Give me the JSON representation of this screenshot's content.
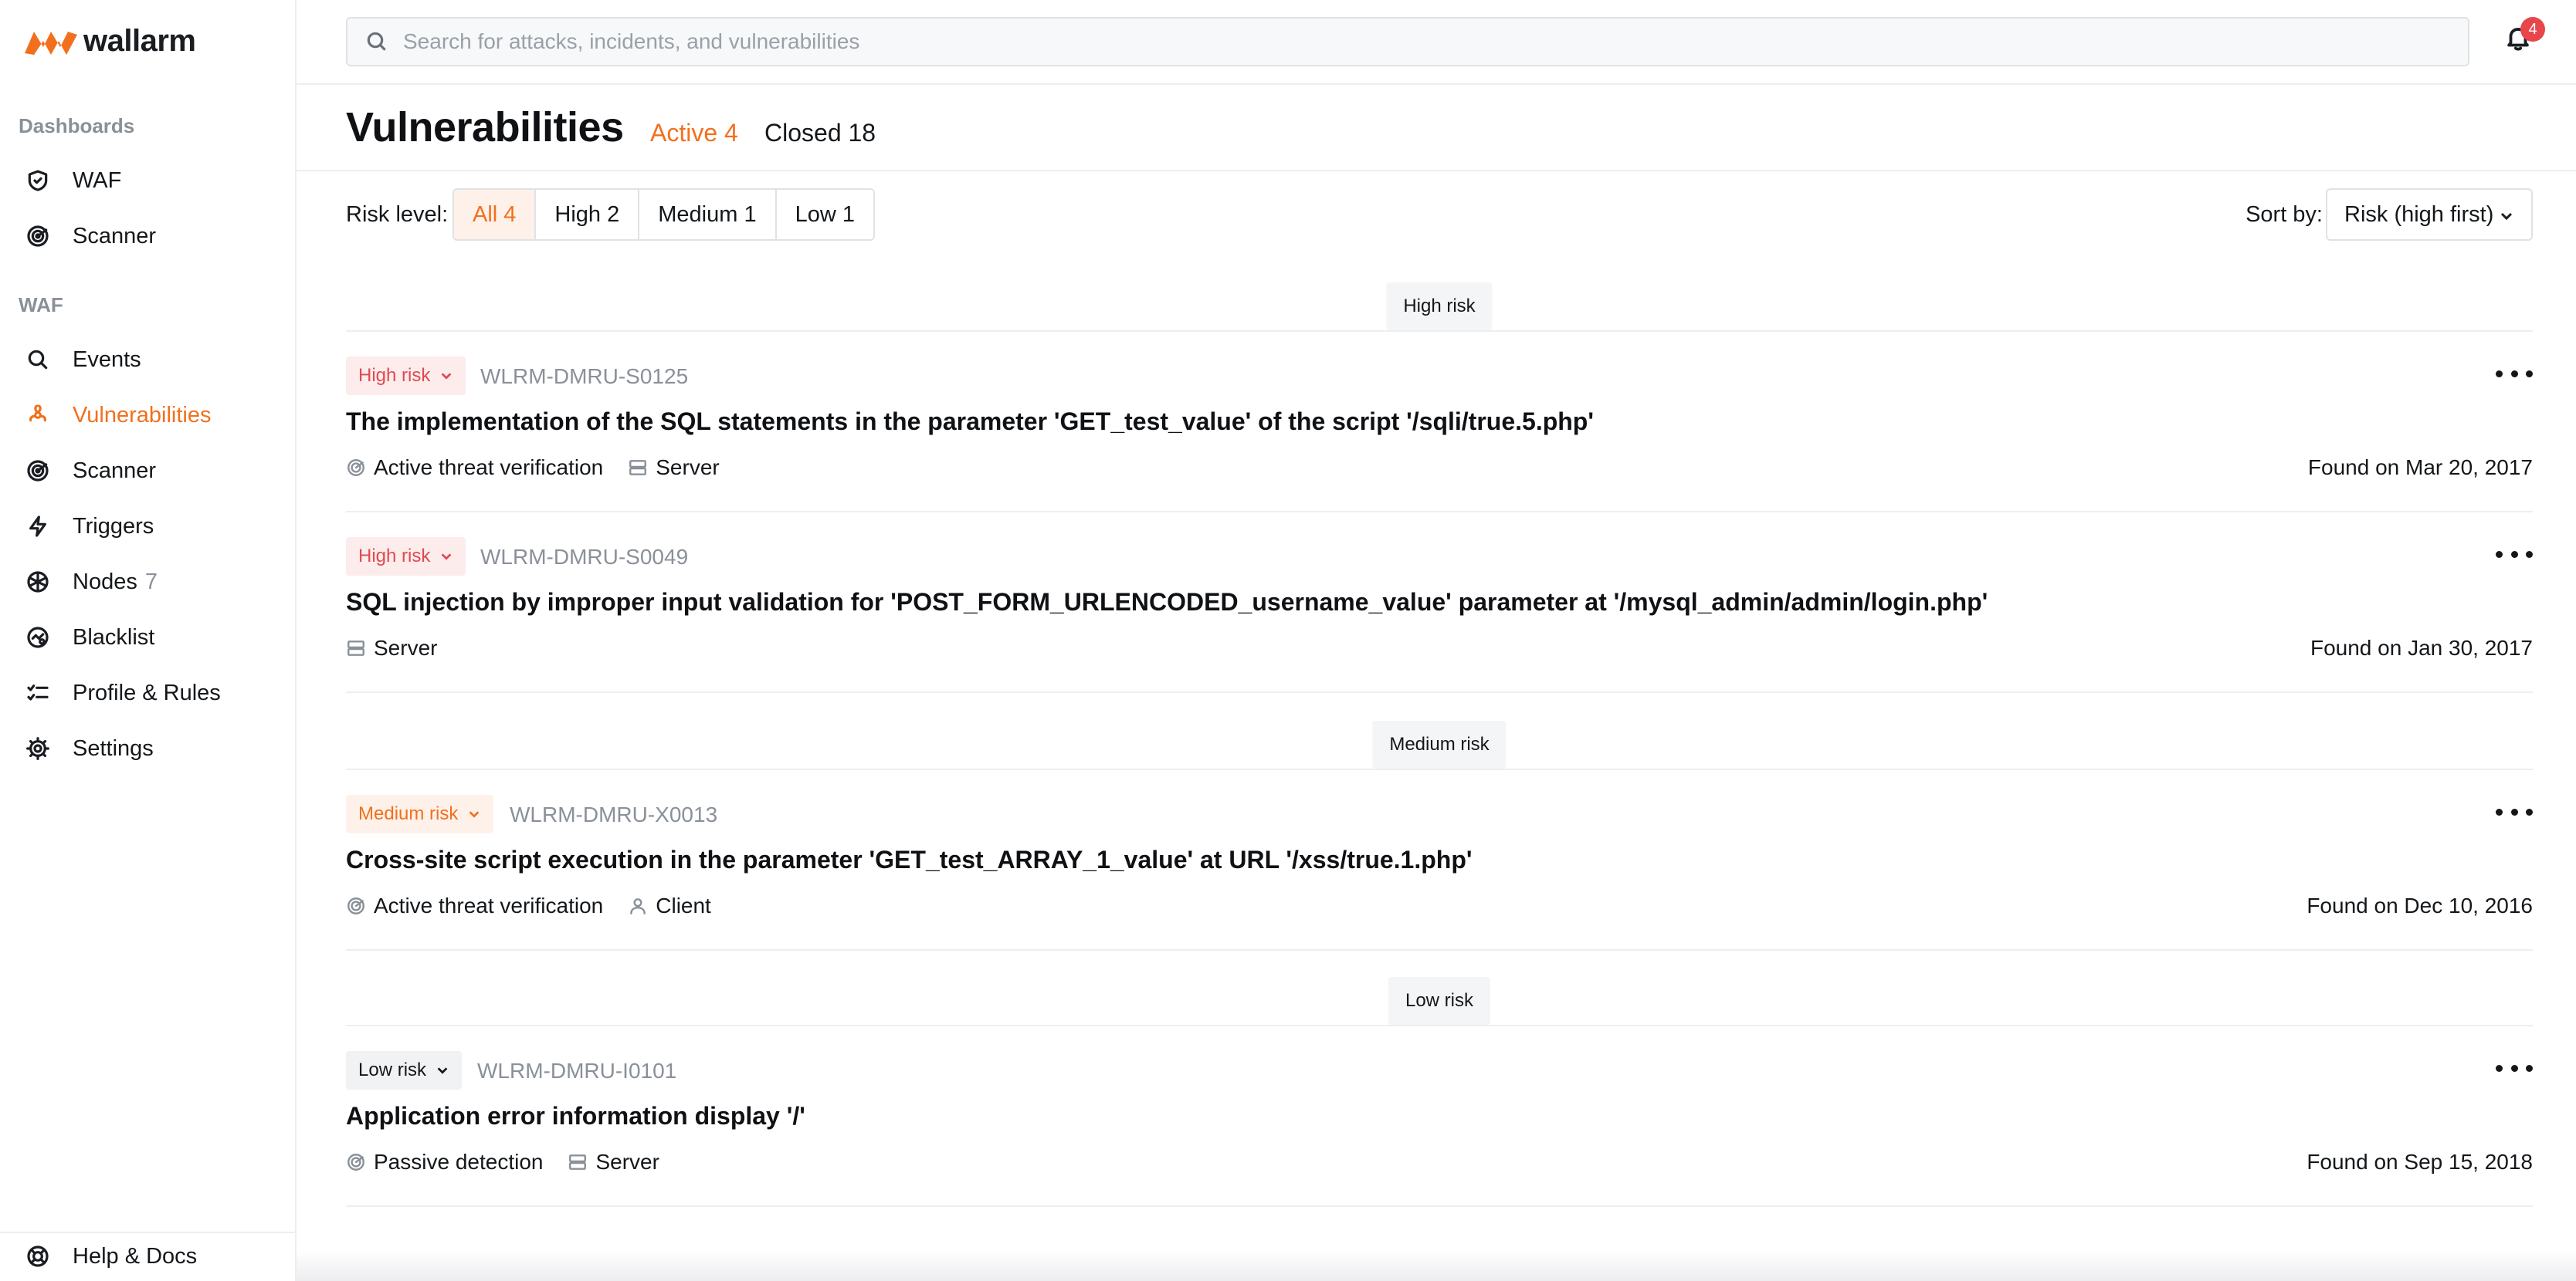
{
  "app": {
    "name": "wallarm"
  },
  "search": {
    "placeholder": "Search for attacks, incidents, and vulnerabilities"
  },
  "notifications": {
    "count": "4"
  },
  "sidebar": {
    "sections": [
      {
        "label": "Dashboards",
        "items": [
          {
            "label": "WAF",
            "icon": "shield-icon"
          },
          {
            "label": "Scanner",
            "icon": "radar-icon"
          }
        ]
      },
      {
        "label": "WAF",
        "items": [
          {
            "label": "Events",
            "icon": "search-icon"
          },
          {
            "label": "Vulnerabilities",
            "icon": "biohazard-icon",
            "active": true
          },
          {
            "label": "Scanner",
            "icon": "radar-icon"
          },
          {
            "label": "Triggers",
            "icon": "bolt-icon"
          },
          {
            "label": "Nodes",
            "icon": "nodes-icon",
            "count": "7"
          },
          {
            "label": "Blacklist",
            "icon": "blacklist-icon"
          },
          {
            "label": "Profile & Rules",
            "icon": "checklist-icon"
          },
          {
            "label": "Settings",
            "icon": "gear-icon"
          }
        ]
      }
    ],
    "help": {
      "label": "Help & Docs",
      "icon": "lifebuoy-icon"
    }
  },
  "header": {
    "title": "Vulnerabilities",
    "tabs": {
      "active": "Active 4",
      "closed": "Closed 18"
    }
  },
  "filters": {
    "risk_label": "Risk level:",
    "options": [
      "All 4",
      "High 2",
      "Medium 1",
      "Low 1"
    ],
    "selected": "All 4",
    "sort_label": "Sort by:",
    "sort_value": "Risk (high first)"
  },
  "groups": {
    "high": "High risk",
    "medium": "Medium risk",
    "low": "Low risk"
  },
  "vulnerabilities": [
    {
      "risk": "High risk",
      "id": "WLRM-DMRU-S0125",
      "title": "The implementation of the SQL statements in the parameter 'GET_test_value' of the script '/sqli/true.5.php'",
      "meta": [
        "Active threat verification",
        "Server"
      ],
      "found": "Found on Mar 20, 2017"
    },
    {
      "risk": "High risk",
      "id": "WLRM-DMRU-S0049",
      "title": "SQL injection by improper input validation for 'POST_FORM_URLENCODED_username_value' parameter at '/mysql_admin/admin/login.php'",
      "meta": [
        "Server"
      ],
      "found": "Found on Jan 30, 2017"
    },
    {
      "risk": "Medium risk",
      "id": "WLRM-DMRU-X0013",
      "title": "Cross-site script execution in the parameter 'GET_test_ARRAY_1_value' at URL '/xss/true.1.php'",
      "meta": [
        "Active threat verification",
        "Client"
      ],
      "found": "Found on Dec 10, 2016"
    },
    {
      "risk": "Low risk",
      "id": "WLRM-DMRU-I0101",
      "title": "Application error information display '/'",
      "meta": [
        "Passive detection",
        "Server"
      ],
      "found": "Found on Sep 15, 2018"
    }
  ],
  "colors": {
    "accent": "#f2701d",
    "high": "#e04a50",
    "badge": "#e8464b"
  }
}
